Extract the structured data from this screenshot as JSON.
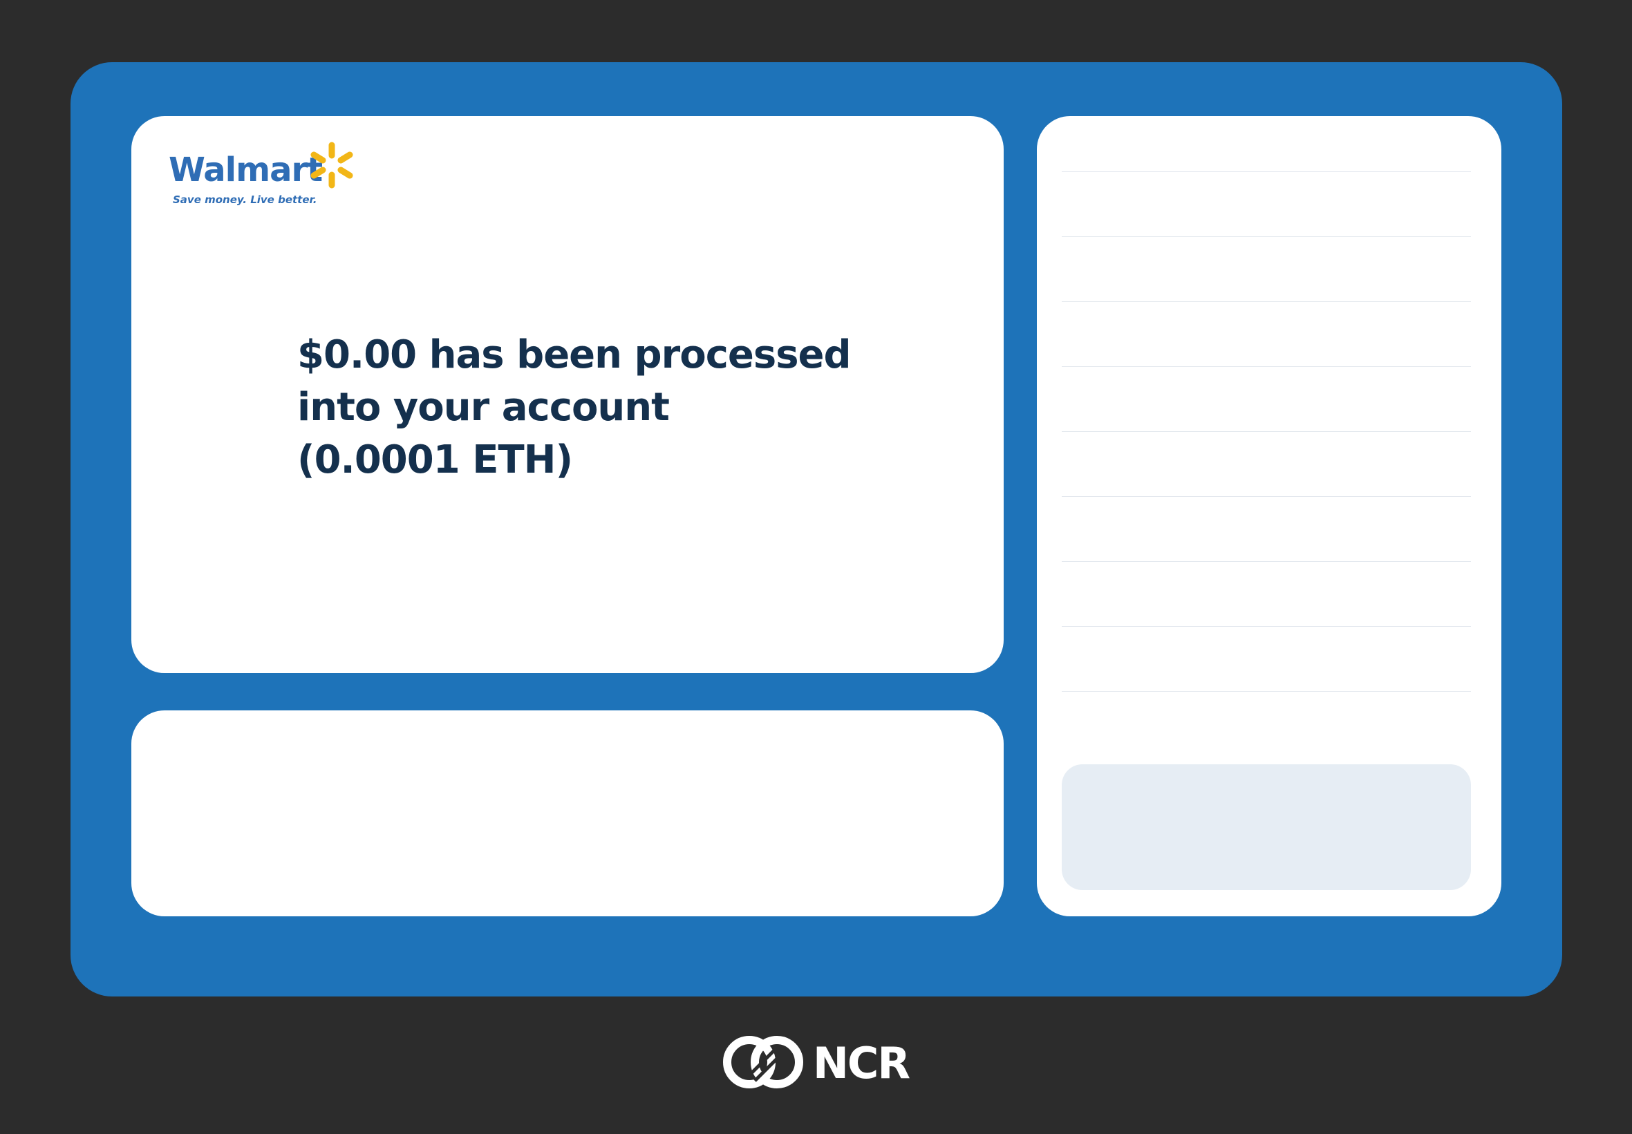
{
  "brand": {
    "name": "Walmart",
    "tagline": "Save money. Live better.",
    "color": "#2f6db5",
    "spark_color": "#f2b617"
  },
  "message": {
    "line1": "$0.00 has been processed",
    "line2": "into your account",
    "line3": "(0.0001 ETH)"
  },
  "receipt": {
    "line_count": 9
  },
  "footer": {
    "vendor": "NCR"
  },
  "colors": {
    "background": "#2c2c2c",
    "screen": "#1e73b9",
    "panel": "#ffffff",
    "text": "#14304d",
    "placeholder": "#e6edf4"
  }
}
